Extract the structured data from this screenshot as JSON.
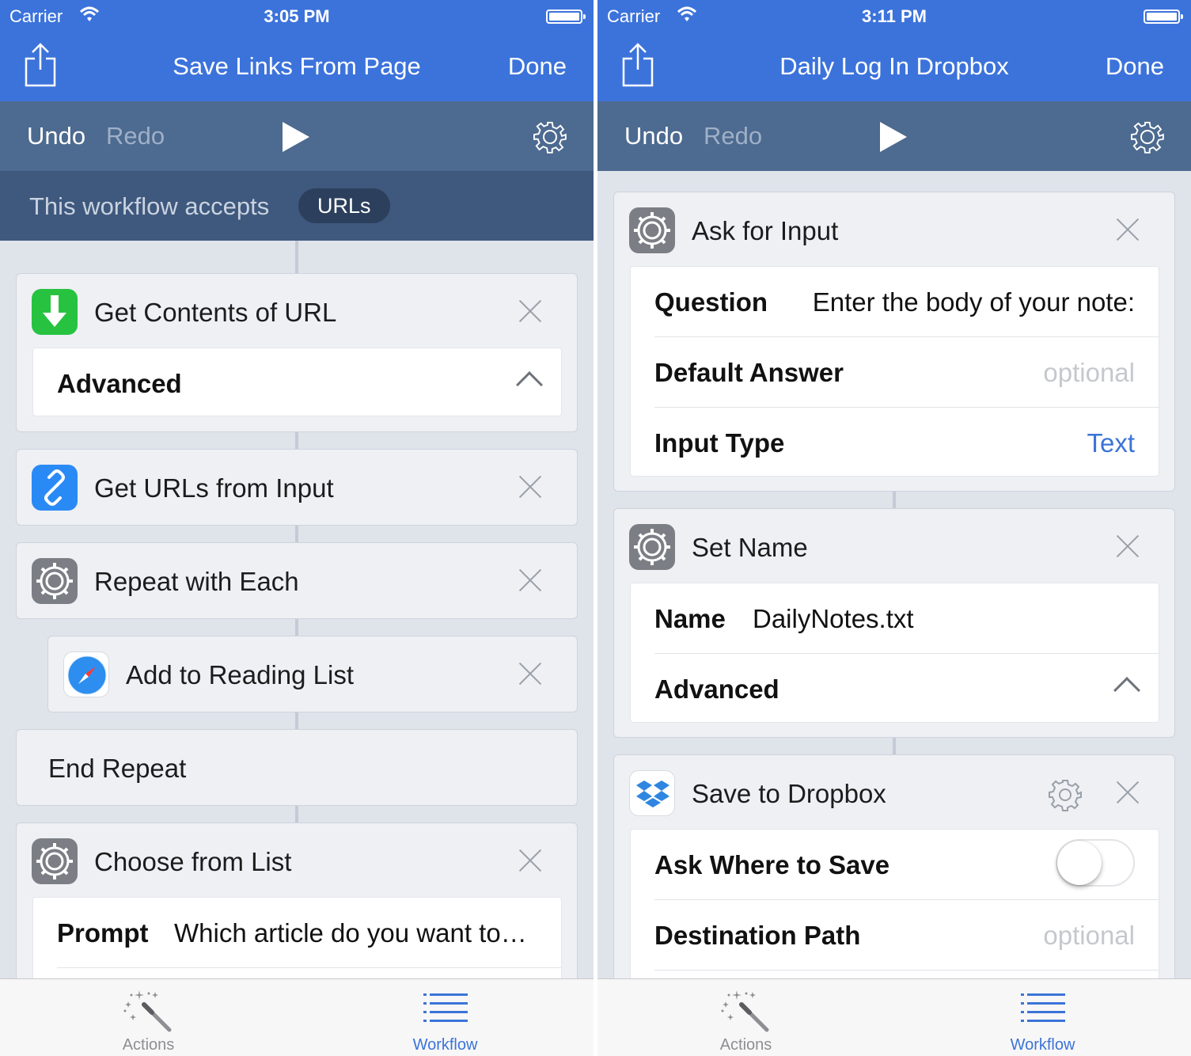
{
  "status": {
    "carrier": "Carrier"
  },
  "left": {
    "time": "3:05 PM",
    "title": "Save Links From Page",
    "done": "Done",
    "undo": "Undo",
    "redo": "Redo",
    "accepts_label": "This workflow accepts",
    "accepts_type": "URLs",
    "actions": {
      "get_contents": {
        "title": "Get Contents of URL",
        "advanced": "Advanced"
      },
      "get_urls": {
        "title": "Get URLs from Input"
      },
      "repeat": {
        "title": "Repeat with Each"
      },
      "reading_list": {
        "title": "Add to Reading List"
      },
      "end_repeat": {
        "title": "End Repeat"
      },
      "choose_list": {
        "title": "Choose from List",
        "prompt_key": "Prompt",
        "prompt_value": "Which article do you want to…"
      }
    }
  },
  "right": {
    "time": "3:11 PM",
    "title": "Daily Log In Dropbox",
    "done": "Done",
    "undo": "Undo",
    "redo": "Redo",
    "actions": {
      "ask_input": {
        "title": "Ask for Input",
        "question_key": "Question",
        "question_value": "Enter the body of your note:",
        "default_key": "Default Answer",
        "default_placeholder": "optional",
        "input_type_key": "Input Type",
        "input_type_value": "Text"
      },
      "set_name": {
        "title": "Set Name",
        "name_key": "Name",
        "name_value": "DailyNotes.txt",
        "advanced": "Advanced"
      },
      "save_dropbox": {
        "title": "Save to Dropbox",
        "ask_where_key": "Ask Where to Save",
        "ask_where_on": false,
        "dest_key": "Destination Path",
        "dest_placeholder": "optional"
      }
    }
  },
  "tabbar": {
    "actions": "Actions",
    "workflow": "Workflow"
  },
  "colors": {
    "nav": "#3c73db",
    "toolbar": "#4d6a90",
    "accepts": "#3f587d",
    "accent": "#3b74d7"
  }
}
